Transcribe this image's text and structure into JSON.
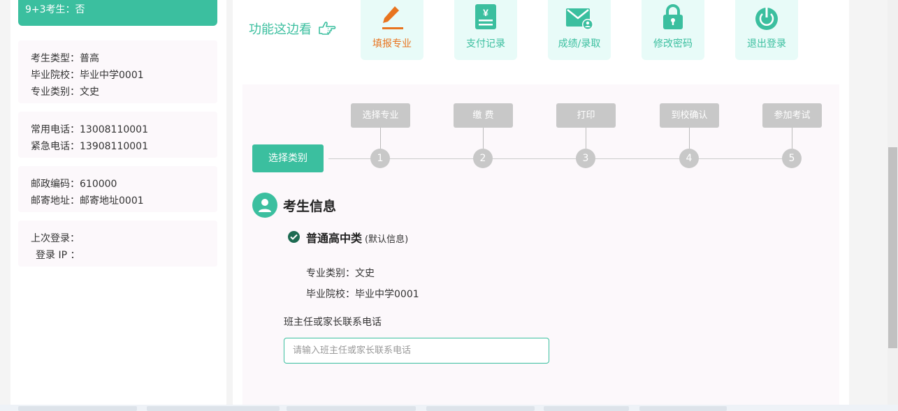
{
  "sidebar": {
    "banner": "9+3考生：否",
    "profile": [
      "考生类型：普高",
      "毕业院校：毕业中学0001",
      "专业类别：文史"
    ],
    "contact": [
      "常用电话：13008110001",
      "紧急电话：13908110001"
    ],
    "address": [
      "邮政编码：610000",
      "邮寄地址：邮寄地址0001"
    ],
    "login": [
      "上次登录：",
      "登录 IP ："
    ]
  },
  "features": {
    "title": "功能这边看",
    "items": [
      {
        "label": "填报专业",
        "icon": "pencil-icon"
      },
      {
        "label": "支付记录",
        "icon": "receipt-icon"
      },
      {
        "label": "成绩/录取",
        "icon": "mail-user-icon"
      },
      {
        "label": "修改密码",
        "icon": "lock-icon"
      },
      {
        "label": "退出登录",
        "icon": "power-icon"
      }
    ]
  },
  "steps": {
    "start_label": "选择类别",
    "items": [
      {
        "label": "选择专业",
        "num": "1"
      },
      {
        "label": "缴 费",
        "num": "2"
      },
      {
        "label": "打印",
        "num": "3"
      },
      {
        "label": "到校确认",
        "num": "4"
      },
      {
        "label": "参加考试",
        "num": "5"
      }
    ]
  },
  "exam_info": {
    "title": "考生信息",
    "type_title": "普通高中类",
    "type_note": "(默认信息)",
    "major": "专业类别：文史",
    "school": "毕业院校：毕业中学0001",
    "phone_label": "班主任或家长联系电话",
    "phone_placeholder": "请输入班主任或家长联系电话",
    "phone_value": ""
  },
  "colors": {
    "accent": "#3bbf9f",
    "active": "#e8741f",
    "step_gray": "#c8c8c8"
  }
}
